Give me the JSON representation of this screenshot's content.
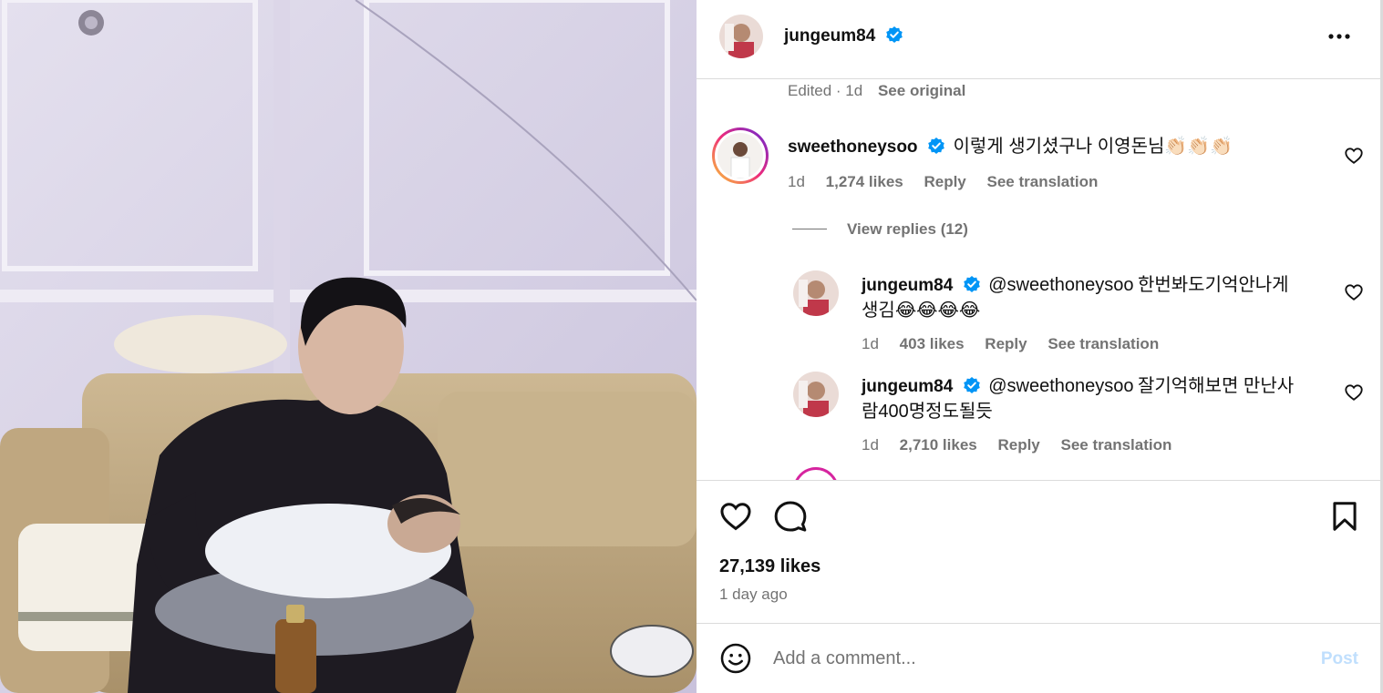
{
  "post": {
    "author": "jungeum84",
    "edited_label": "Edited · 1d",
    "see_original": "See original"
  },
  "comments": [
    {
      "username": "sweethoneysoo",
      "text": "이렇게 생기셨구나 이영돈님",
      "emoji": "👏🏻👏🏻👏🏻",
      "time": "1d",
      "likes": "1,274 likes",
      "reply": "Reply",
      "translation": "See translation"
    }
  ],
  "view_replies": "View replies (12)",
  "replies": [
    {
      "username": "jungeum84",
      "mention": "@sweethoneysoo",
      "text_line1": "한번봐도기억안나게",
      "text_line2": "생김",
      "emoji": "😂😂😂😂",
      "time": "1d",
      "likes": "403 likes",
      "reply": "Reply",
      "translation": "See translation"
    },
    {
      "username": "jungeum84",
      "mention": "@sweethoneysoo",
      "text_line1": "잘기억해보면 만난사",
      "text_line2": "람400명정도될듯",
      "time": "1d",
      "likes": "2,710 likes",
      "reply": "Reply",
      "translation": "See translation"
    }
  ],
  "stats": {
    "likes": "27,139 likes",
    "time_ago": "1 day ago"
  },
  "comment_box": {
    "placeholder": "Add a comment...",
    "post_label": "Post"
  },
  "icons": {
    "verified": "verified-badge-icon",
    "more": "more-options-icon",
    "like": "heart-icon",
    "comment": "comment-bubble-icon",
    "save": "bookmark-icon",
    "emoji": "smiley-icon"
  },
  "colors": {
    "verified_blue": "#0095f6",
    "muted_text": "#737373",
    "mention": "#00376b",
    "post_disabled": "#c0dffd",
    "story_ring": "#d6249f"
  }
}
